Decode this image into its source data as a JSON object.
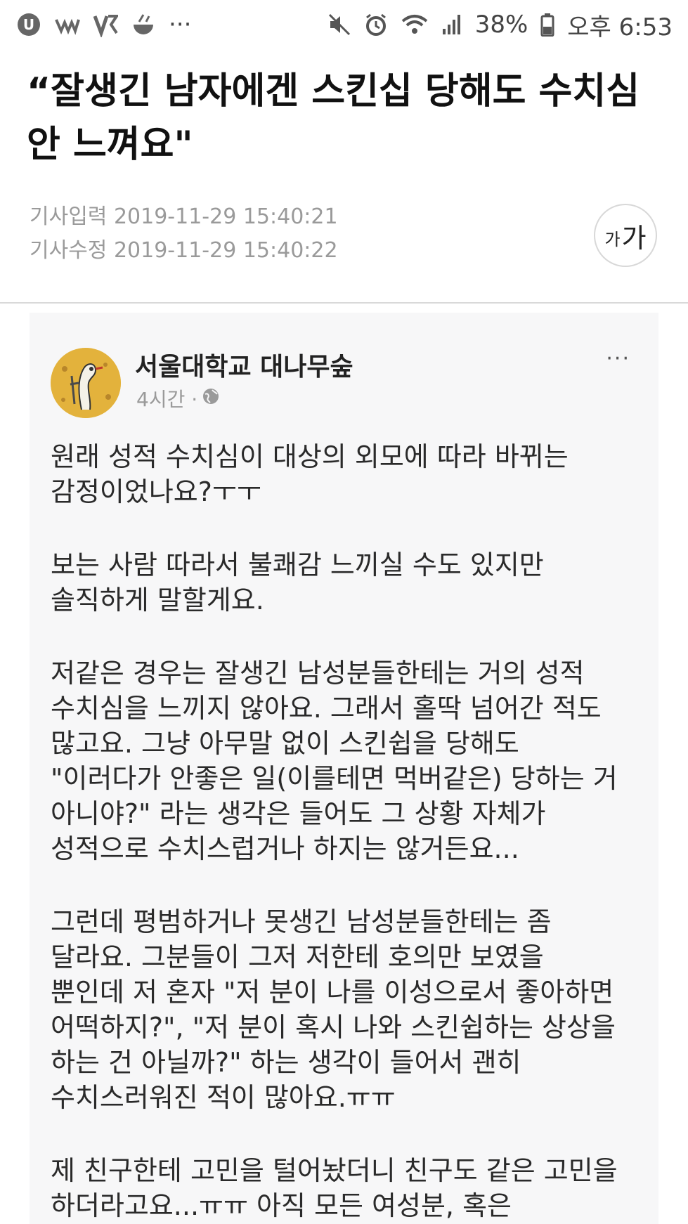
{
  "status_bar": {
    "battery": "38%",
    "time": "오후 6:53",
    "dots": "···"
  },
  "article": {
    "headline": "“잘생긴 남자에겐 스킨십 당해도 수치심 안 느껴요\"",
    "input_label": "기사입력",
    "input_time": "2019-11-29 15:40:21",
    "edit_label": "기사수정",
    "edit_time": "2019-11-29 15:40:22",
    "font_small": "가",
    "font_big": "가"
  },
  "post": {
    "page_name": "서울대학교 대나무숲",
    "time": "4시간 ·",
    "more": "···",
    "paragraphs": [
      "원래 성적 수치심이 대상의 외모에 따라 바뀌는\n감정이었나요?ㅜㅜ",
      "보는 사람 따라서 불쾌감 느끼실 수도 있지만\n솔직하게 말할게요.",
      "저같은 경우는 잘생긴 남성분들한테는 거의 성적\n수치심을 느끼지 않아요. 그래서 홀딱 넘어간 적도\n많고요. 그냥 아무말 없이 스킨쉽을 당해도\n\"이러다가 안좋은 일(이를테면 먹버같은) 당하는 거\n아니야?\" 라는 생각은 들어도 그 상황 자체가\n성적으로 수치스럽거나 하지는 않거든요...",
      "그런데 평범하거나 못생긴 남성분들한테는 좀\n달라요. 그분들이 그저 저한테 호의만 보였을\n뿐인데 저 혼자 \"저 분이 나를 이성으로서 좋아하면\n어떡하지?\", \"저 분이 혹시 나와 스킨쉽하는 상상을\n하는 건 아닐까?\" 하는 생각이 들어서 괜히\n수치스러워진 적이 많아요.ㅠㅠ",
      "제 친구한테 고민을 털어놨더니 친구도 같은 고민을\n하더라고요...ㅠㅠ 아직 모든 여성분, 혹은"
    ]
  }
}
